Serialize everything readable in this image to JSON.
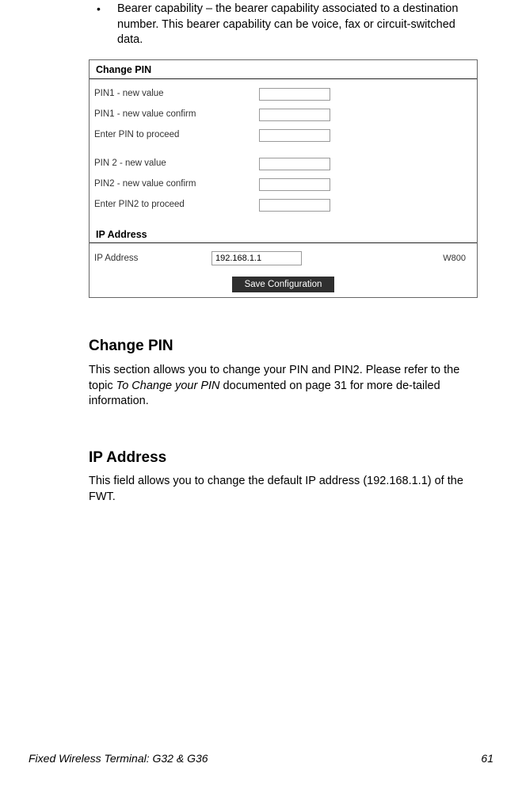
{
  "bullet": {
    "term": "Bearer capability",
    "text": " – the bearer capability associated to a destination number. This bearer capability can be voice, fax or circuit-switched data."
  },
  "figure": {
    "changePin": {
      "title": "Change PIN",
      "rows1": [
        "PIN1 - new value",
        "PIN1 - new value confirm",
        "Enter PIN to proceed"
      ],
      "rows2": [
        "PIN 2 - new value",
        "PIN2 - new value confirm",
        "Enter PIN2 to proceed"
      ]
    },
    "ip": {
      "title": "IP Address",
      "label": "IP Address",
      "value": "192.168.1.1",
      "right": "W800"
    },
    "save": "Save Configuration"
  },
  "sections": {
    "changePin": {
      "heading": "Change PIN",
      "p1a": "This section allows you to change your PIN and PIN2.  Please refer to the topic ",
      "p1i": "To Change your PIN",
      "p1b": " documented on page 31 for more de-tailed information."
    },
    "ip": {
      "heading": "IP Address",
      "p": "This field allows you to change the default IP address (192.168.1.1) of the FWT."
    }
  },
  "footer": {
    "left": "Fixed Wireless Terminal: G32 & G36",
    "right": "61"
  }
}
